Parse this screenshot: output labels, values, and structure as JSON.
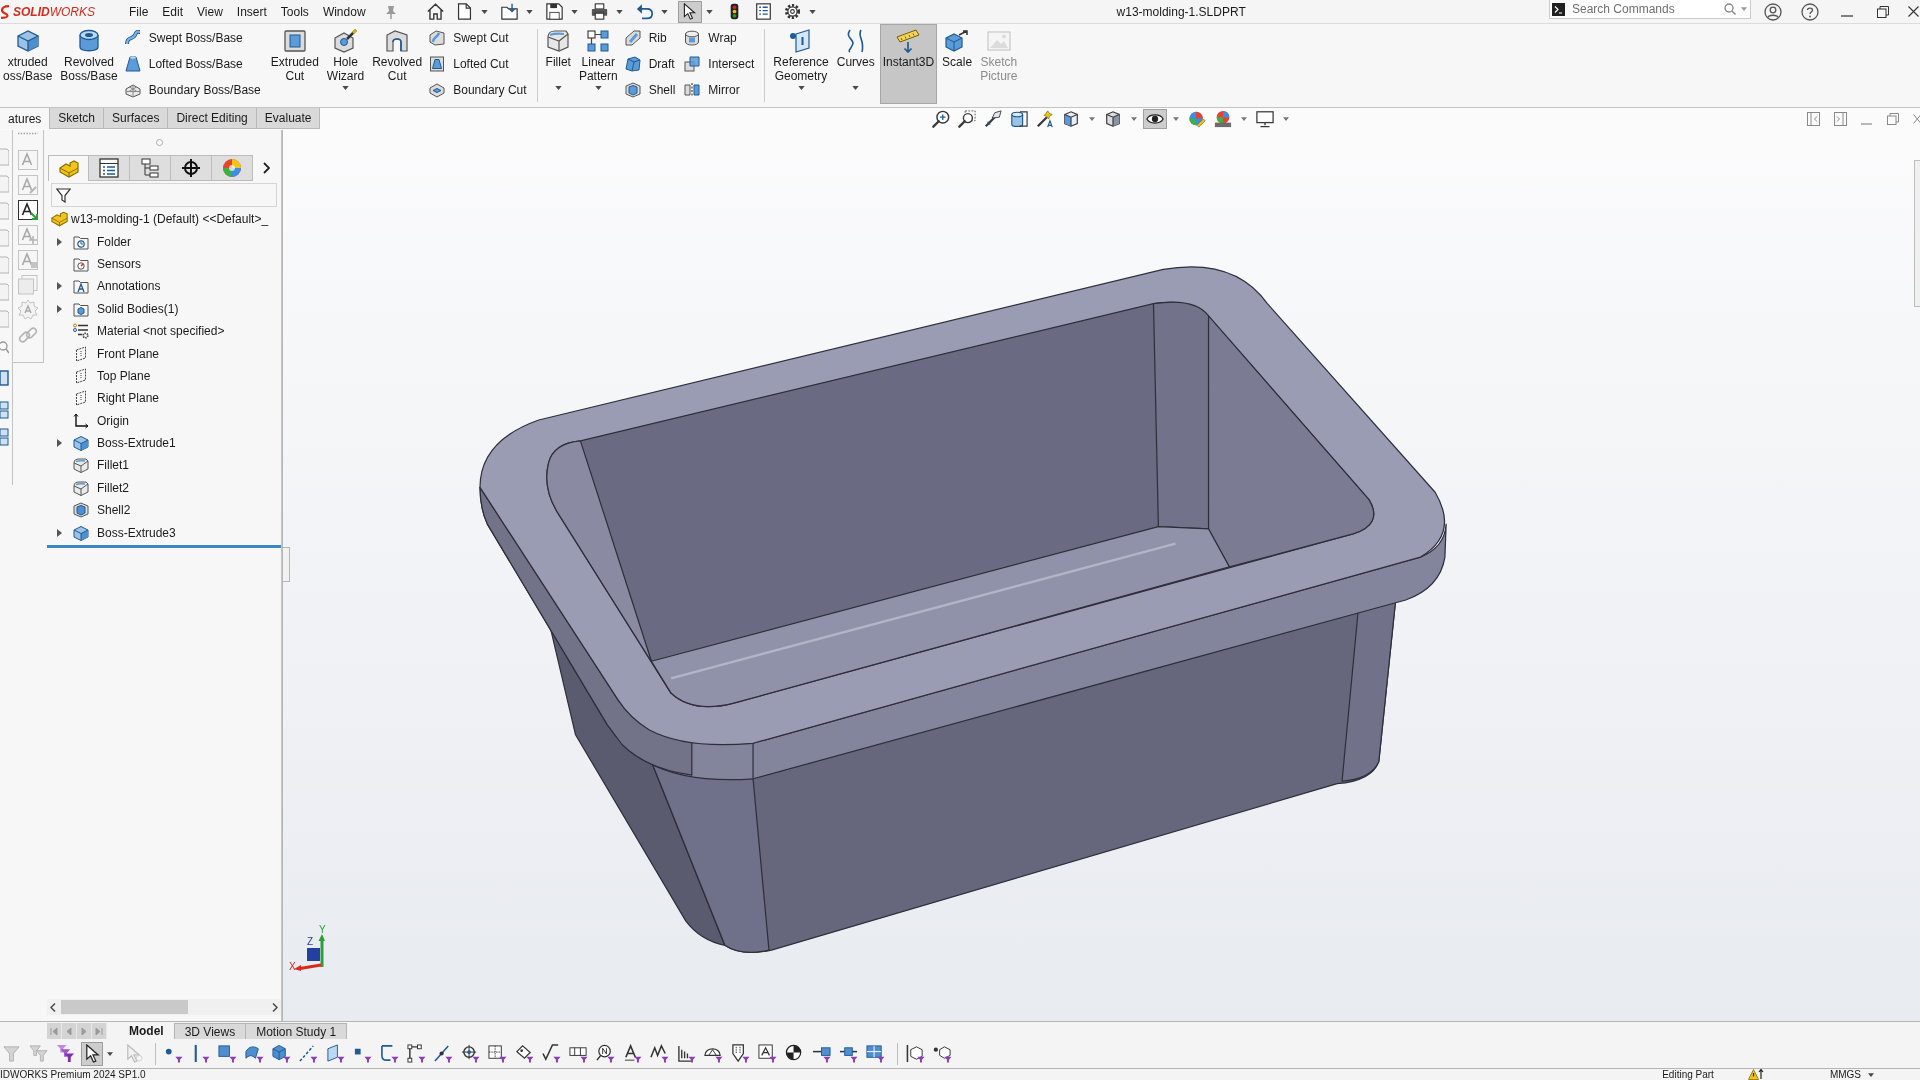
{
  "title_bar": {
    "logo": "**SOLID**WORKS",
    "menus": [
      {
        "label": "File"
      },
      {
        "label": "Edit"
      },
      {
        "label": "View"
      },
      {
        "label": "Insert"
      },
      {
        "label": "Tools"
      },
      {
        "label": "Window"
      }
    ],
    "document_title": "w13-molding-1.SLDPRT",
    "search": {
      "placeholder": "Search Commands"
    }
  },
  "quick_access_toolbar": [
    {
      "kind": "home",
      "dropdown": false,
      "selected": false
    },
    {
      "kind": "new",
      "dropdown": true,
      "selected": false
    },
    {
      "kind": "open",
      "dropdown": true,
      "selected": false
    },
    {
      "kind": "save",
      "dropdown": true,
      "selected": false
    },
    {
      "kind": "print",
      "dropdown": true,
      "selected": false
    },
    {
      "kind": "undo",
      "dropdown": true,
      "selected": false
    },
    {
      "kind": "select",
      "dropdown": true,
      "selected": true
    },
    {
      "kind": "rebuild",
      "dropdown": false,
      "selected": false
    },
    {
      "kind": "properties",
      "dropdown": false,
      "selected": false
    },
    {
      "kind": "options",
      "dropdown": true,
      "selected": false
    }
  ],
  "ribbon": {
    "groups": [
      {
        "kind": "large",
        "items": [
          {
            "kind": "extrude",
            "label": "xtruded oss/Base",
            "dropdown": false,
            "selected": false,
            "disabled": false
          },
          {
            "kind": "revolve",
            "label": "Revolved Boss/Base",
            "dropdown": false,
            "selected": false,
            "disabled": false
          }
        ]
      },
      {
        "kind": "column",
        "items": [
          {
            "kind": "sweep",
            "label": "Swept Boss/Base"
          },
          {
            "kind": "loft",
            "label": "Lofted Boss/Base"
          },
          {
            "kind": "boundary",
            "label": "Boundary Boss/Base"
          }
        ]
      },
      {
        "kind": "large",
        "items": [
          {
            "kind": "cut_extrude",
            "label": "Extruded Cut",
            "dropdown": false,
            "selected": false,
            "disabled": false
          },
          {
            "kind": "hole_wizard",
            "label": "Hole Wizard",
            "dropdown": true,
            "selected": false,
            "disabled": false
          },
          {
            "kind": "cut_revolve",
            "label": "Revolved Cut",
            "dropdown": false,
            "selected": false,
            "disabled": false
          }
        ]
      },
      {
        "kind": "column",
        "items": [
          {
            "kind": "cut_sweep",
            "label": "Swept Cut"
          },
          {
            "kind": "cut_loft",
            "label": "Lofted Cut"
          },
          {
            "kind": "cut_boundary",
            "label": "Boundary Cut"
          }
        ]
      },
      {
        "kind": "large",
        "items": [
          {
            "kind": "fillet",
            "label": "Fillet",
            "dropdown": true,
            "selected": false,
            "disabled": false
          },
          {
            "kind": "linear_pattern",
            "label": "Linear Pattern",
            "dropdown": true,
            "selected": false,
            "disabled": false
          }
        ]
      },
      {
        "kind": "column",
        "items": [
          {
            "kind": "rib",
            "label": "Rib"
          },
          {
            "kind": "draft",
            "label": "Draft"
          },
          {
            "kind": "shell",
            "label": "Shell"
          }
        ]
      },
      {
        "kind": "column",
        "items": [
          {
            "kind": "wrap",
            "label": "Wrap"
          },
          {
            "kind": "intersect",
            "label": "Intersect"
          },
          {
            "kind": "mirror",
            "label": "Mirror"
          }
        ]
      },
      {
        "kind": "large",
        "items": [
          {
            "kind": "reference",
            "label": "Reference Geometry",
            "dropdown": true,
            "selected": false,
            "disabled": false
          },
          {
            "kind": "curves",
            "label": "Curves",
            "dropdown": true,
            "selected": false,
            "disabled": false
          },
          {
            "kind": "instant3d",
            "label": "Instant3D",
            "dropdown": false,
            "selected": true,
            "disabled": false
          },
          {
            "kind": "scale",
            "label": "Scale",
            "dropdown": false,
            "selected": false,
            "disabled": false
          },
          {
            "kind": "sketch_picture",
            "label": "Sketch Picture",
            "dropdown": false,
            "selected": false,
            "disabled": true
          }
        ]
      }
    ]
  },
  "ribbon_tabs": [
    {
      "label": "atures",
      "selected": true
    },
    {
      "label": "Sketch",
      "selected": false
    },
    {
      "label": "Surfaces",
      "selected": false
    },
    {
      "label": "Direct Editing",
      "selected": false
    },
    {
      "label": "Evaluate",
      "selected": false
    }
  ],
  "heads_up_toolbar": [
    {
      "kind": "zoom_fit",
      "dropdown": false,
      "selected": false
    },
    {
      "kind": "zoom_area",
      "dropdown": false,
      "selected": false
    },
    {
      "kind": "previous_view",
      "dropdown": false,
      "selected": false
    },
    {
      "kind": "section_view",
      "dropdown": false,
      "selected": false
    },
    {
      "kind": "dynamic_annotation",
      "dropdown": false,
      "selected": false
    },
    {
      "kind": "view_orientation",
      "dropdown": true,
      "selected": false
    },
    {
      "kind": "display_style",
      "dropdown": true,
      "selected": false
    },
    {
      "kind": "hide_show",
      "dropdown": true,
      "selected": true
    },
    {
      "kind": "edit_appearance",
      "dropdown": false,
      "selected": false
    },
    {
      "kind": "apply_scene",
      "dropdown": true,
      "selected": false
    },
    {
      "kind": "view_settings",
      "dropdown": true,
      "selected": false
    }
  ],
  "feature_manager": {
    "tabs": [
      {
        "kind": "features",
        "selected": true
      },
      {
        "kind": "properties",
        "selected": false
      },
      {
        "kind": "configurations",
        "selected": false
      },
      {
        "kind": "dimxpert",
        "selected": false
      },
      {
        "kind": "display",
        "selected": false
      }
    ],
    "tree": {
      "label": "w13-molding-1 (Default) <<Default>_",
      "kind": "part",
      "children": [
        {
          "label": "Folder",
          "kind": "folder",
          "expandable": true
        },
        {
          "label": "Sensors",
          "kind": "sensors",
          "expandable": false
        },
        {
          "label": "Annotations",
          "kind": "annotations",
          "expandable": true
        },
        {
          "label": "Solid Bodies(1)",
          "kind": "solid_bodies",
          "expandable": true
        },
        {
          "label": "Material <not specified>",
          "kind": "material",
          "expandable": false
        },
        {
          "label": "Front Plane",
          "kind": "plane",
          "expandable": false
        },
        {
          "label": "Top Plane",
          "kind": "plane",
          "expandable": false
        },
        {
          "label": "Right Plane",
          "kind": "plane",
          "expandable": false
        },
        {
          "label": "Origin",
          "kind": "origin",
          "expandable": false
        },
        {
          "label": "Boss-Extrude1",
          "kind": "extrude",
          "expandable": true
        },
        {
          "label": "Fillet1",
          "kind": "fillet",
          "expandable": false
        },
        {
          "label": "Fillet2",
          "kind": "fillet",
          "expandable": false
        },
        {
          "label": "Shell2",
          "kind": "shell",
          "expandable": false
        },
        {
          "label": "Boss-Extrude3",
          "kind": "extrude",
          "expandable": true
        }
      ]
    }
  },
  "triad": {
    "axes": [
      {
        "label": "Y"
      },
      {
        "label": "Z"
      },
      {
        "label": "X"
      }
    ]
  },
  "model_tabs": [
    {
      "label": "Model",
      "selected": true
    },
    {
      "label": "3D Views",
      "selected": false
    },
    {
      "label": "Motion Study 1",
      "selected": false
    }
  ],
  "selection_filter_toolbar": [
    {
      "kind": "funnel",
      "dropdown": false,
      "selected": false
    },
    {
      "kind": "double_funnel",
      "dropdown": false,
      "selected": false
    },
    {
      "kind": "clear_filters",
      "dropdown": false,
      "selected": false
    },
    {
      "kind": "select",
      "dropdown": true,
      "selected": true
    },
    {
      "kind": "select_other",
      "dropdown": false,
      "selected": false
    },
    {
      "kind": "vertex",
      "dropdown": false,
      "selected": false
    },
    {
      "kind": "edge",
      "dropdown": false,
      "selected": false
    },
    {
      "kind": "face",
      "dropdown": false,
      "selected": false
    },
    {
      "kind": "surface",
      "dropdown": false,
      "selected": false
    },
    {
      "kind": "solid",
      "dropdown": false,
      "selected": false
    },
    {
      "kind": "axis",
      "dropdown": false,
      "selected": false
    },
    {
      "kind": "plane",
      "dropdown": false,
      "selected": false
    },
    {
      "kind": "sketch_point",
      "dropdown": false,
      "selected": false
    },
    {
      "kind": "sketch_segment",
      "dropdown": false,
      "selected": false
    },
    {
      "kind": "sketch",
      "dropdown": false,
      "selected": false
    },
    {
      "kind": "midpoint",
      "dropdown": false,
      "selected": false
    },
    {
      "kind": "center_mark",
      "dropdown": false,
      "selected": false
    },
    {
      "kind": "dimension",
      "dropdown": false,
      "selected": false
    },
    {
      "kind": "tag",
      "dropdown": false,
      "selected": false
    },
    {
      "kind": "surface_finish",
      "dropdown": false,
      "selected": false
    },
    {
      "kind": "frame",
      "dropdown": false,
      "selected": false
    },
    {
      "kind": "balloon",
      "dropdown": false,
      "selected": false
    },
    {
      "kind": "note",
      "dropdown": false,
      "selected": false
    },
    {
      "kind": "weld",
      "dropdown": false,
      "selected": false
    },
    {
      "kind": "hatch",
      "dropdown": false,
      "selected": false
    },
    {
      "kind": "dome",
      "dropdown": false,
      "selected": false
    },
    {
      "kind": "cone",
      "dropdown": false,
      "selected": false
    },
    {
      "kind": "boxed_note",
      "dropdown": false,
      "selected": false
    },
    {
      "kind": "center_mass",
      "dropdown": false,
      "selected": false
    },
    {
      "kind": "pin",
      "dropdown": false,
      "selected": false
    },
    {
      "kind": "connector",
      "dropdown": false,
      "selected": false
    },
    {
      "kind": "block",
      "dropdown": false,
      "selected": false
    },
    {
      "kind": "mate_cube",
      "dropdown": false,
      "selected": false
    },
    {
      "kind": "point_cube",
      "dropdown": false,
      "selected": false
    }
  ],
  "status_bar": {
    "product": "IDWORKS Premium 2024 SP1.0",
    "mode": "Editing Part",
    "units": "MMGS"
  }
}
